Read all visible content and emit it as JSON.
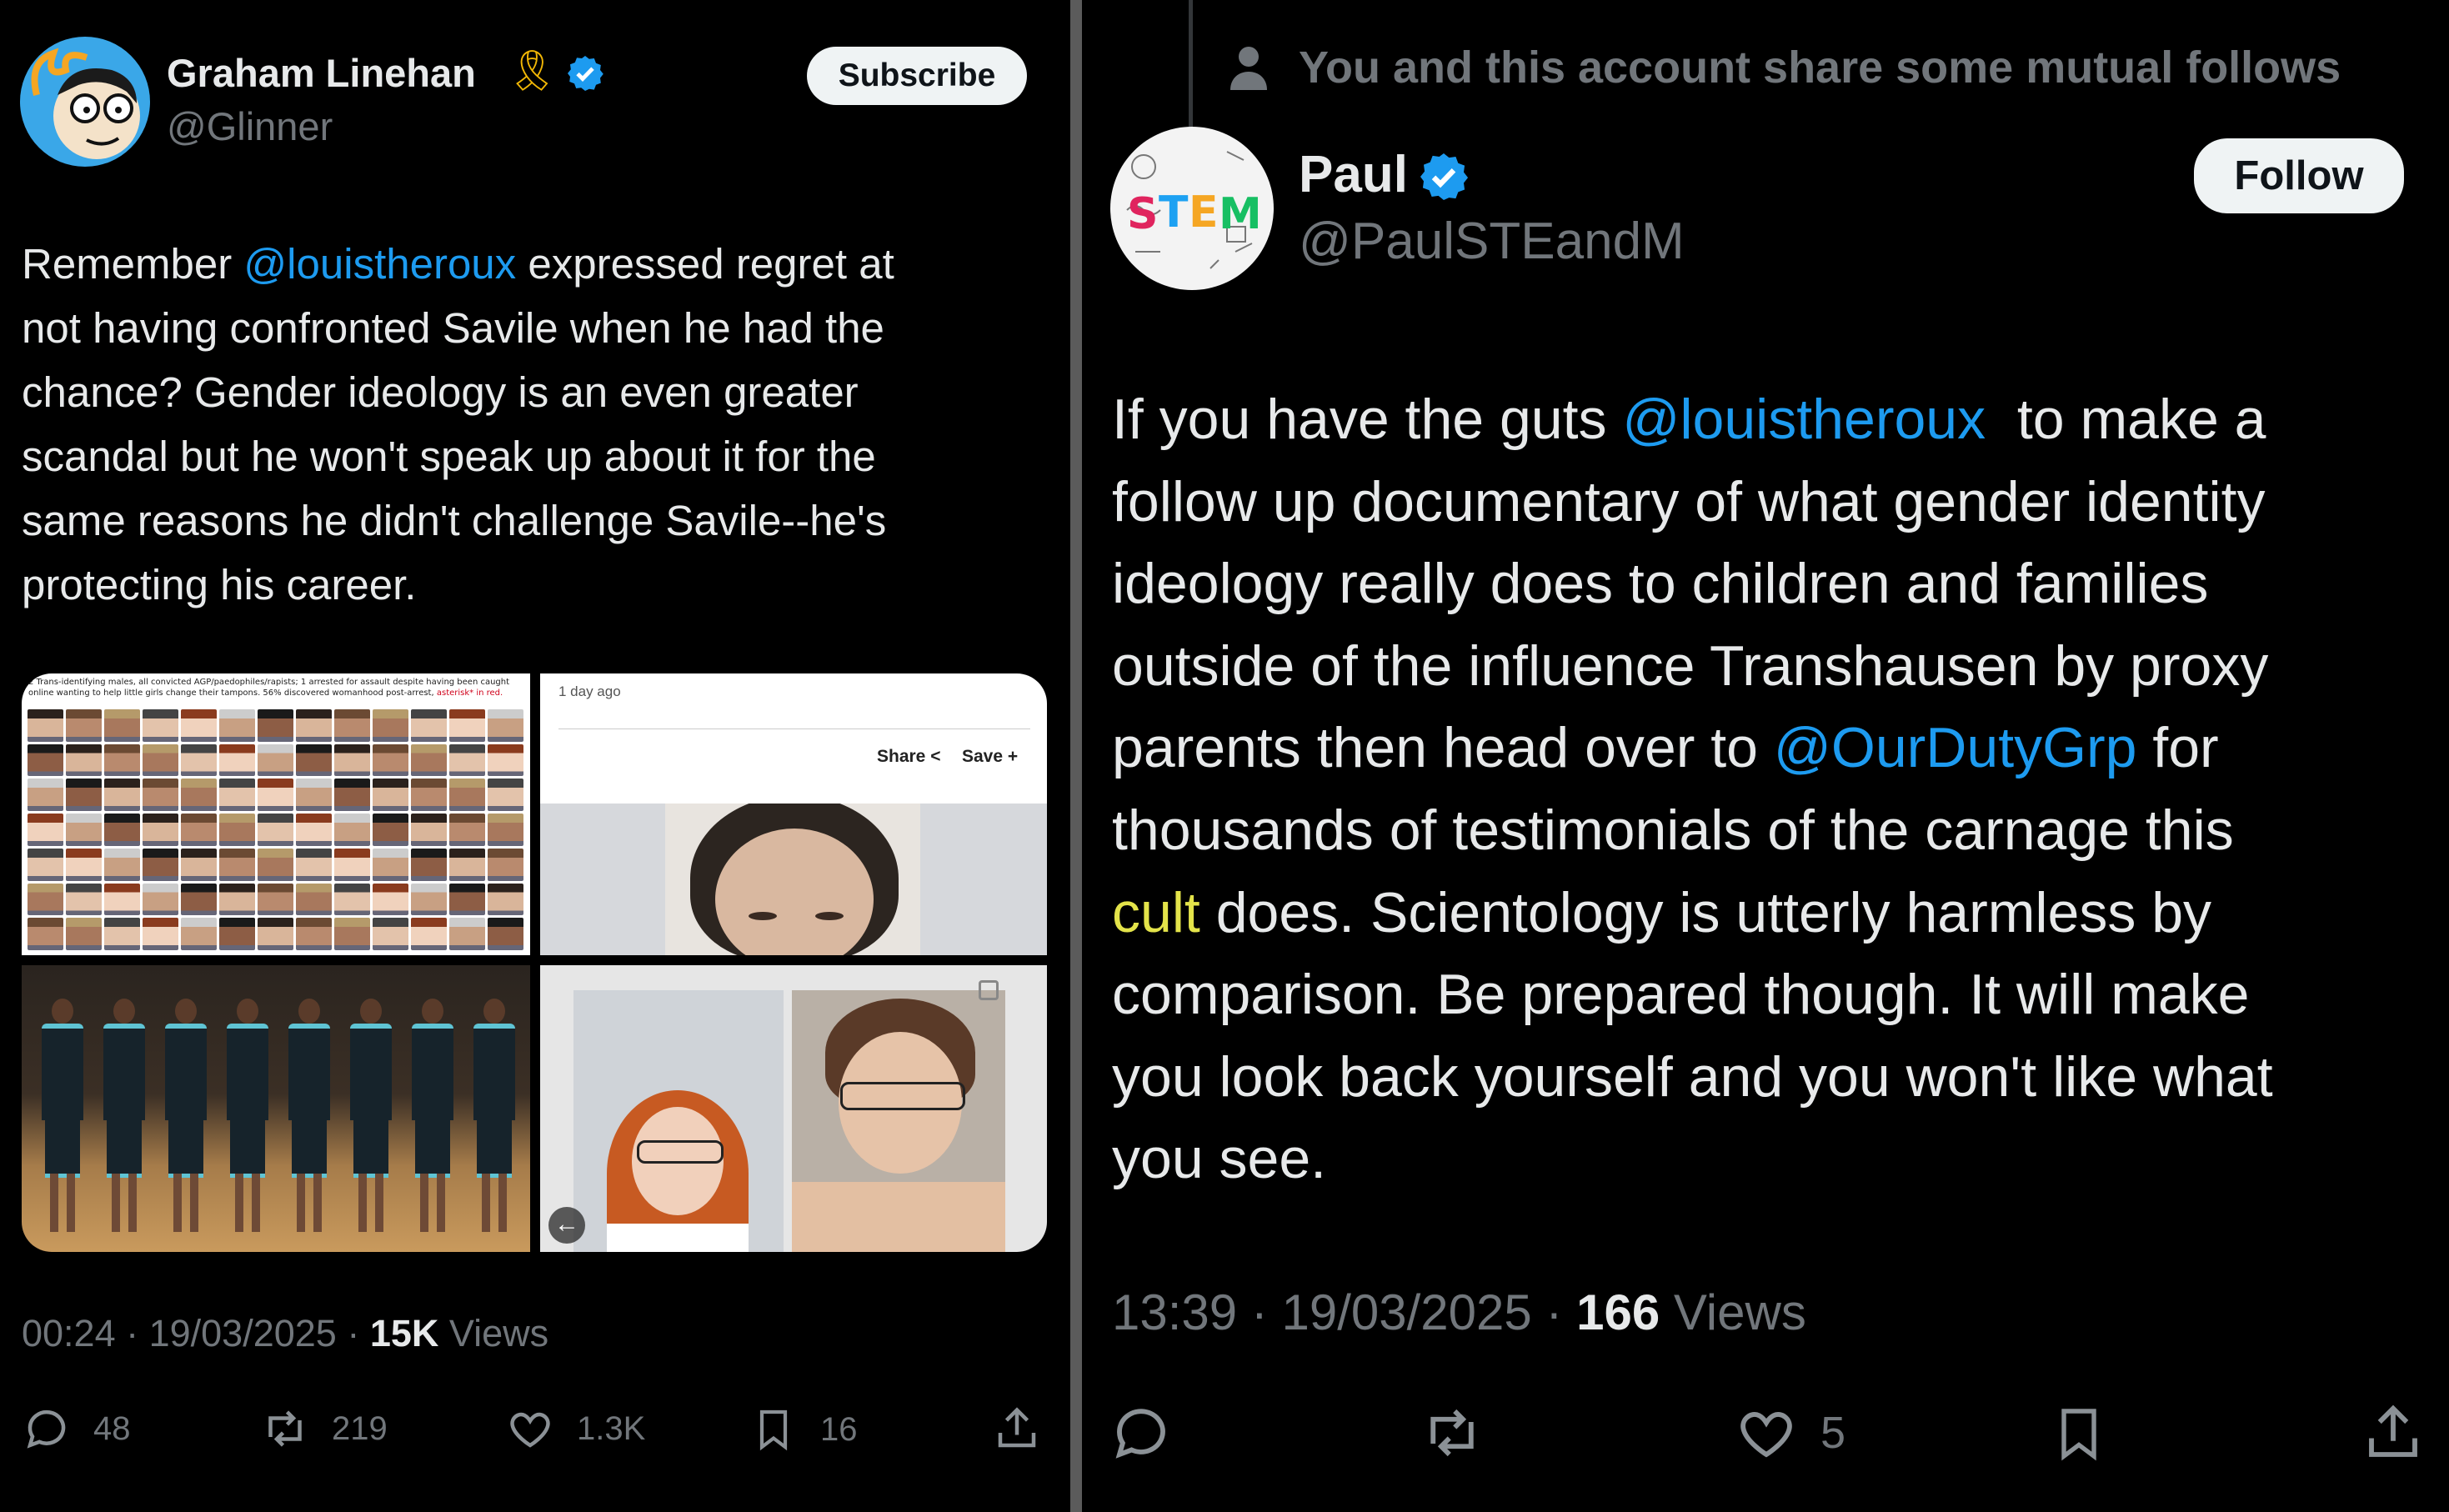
{
  "left_tweet": {
    "author_name": "Graham Linehan",
    "ribbon": "🎗",
    "author_handle": "@Glinner",
    "subscribe_label": "Subscribe",
    "body": {
      "line1_pre": "Remember ",
      "mention": "@louistheroux",
      "line1_post": " expressed regret at",
      "line2": "not having confronted Savile when he had the",
      "line3": "chance? Gender ideology is an even greater",
      "line4": "scandal but he won't speak up about it for the",
      "line5": "same reasons he didn't challenge Savile--he's",
      "line6": "protecting his career."
    },
    "media": {
      "collage_caption": "2 Trans-identifying males, all convicted AGP/paedophiles/rapists; 1 arrested for assault despite having been caught online wanting to help little girls change their tampons. 56% discovered womanhood post-arrest,",
      "collage_caption_red": "asterisk* in red.",
      "article_time": "1 day ago",
      "share_label": "Share",
      "save_label": "Save"
    },
    "timestamp": "00:24 · 19/03/2025 · ",
    "views_count": "15K",
    "views_label": " Views",
    "actions": {
      "replies": "48",
      "reposts": "219",
      "likes": "1.3K",
      "bookmarks": "16"
    }
  },
  "right_tweet": {
    "context_text": "You and this account share some mutual follows",
    "author_name": "Paul",
    "author_handle": "@PaulSTEandM",
    "avatar_text": "STEM",
    "follow_label": "Follow",
    "body": {
      "l1_pre": "If you have the guts ",
      "l1_mention": "@louistheroux",
      "l1_post": "  to make a",
      "l2": "follow up documentary of what gender identity",
      "l3": "ideology really does to children and families",
      "l4": "outside of the influence Transhausen by proxy",
      "l5_pre": "parents then head over to ",
      "l5_mention": "@OurDutyGrp",
      "l5_post": " for",
      "l6": "thousands of testimonials of the carnage this",
      "l7_hl": "cult",
      "l7_post": " does. Scientology is utterly harmless by",
      "l8": "comparison. Be prepared though. It will make",
      "l9": "you look back yourself and you won't like what",
      "l10": "you see."
    },
    "timestamp": "13:39 · 19/03/2025 · ",
    "views_count": "166",
    "views_label": " Views",
    "actions": {
      "likes": "5"
    }
  },
  "colors": {
    "accent": "#1d9bf0",
    "highlight": "#e3e34a",
    "muted": "#71767b",
    "text": "#e7e9ea",
    "background": "#000000"
  }
}
